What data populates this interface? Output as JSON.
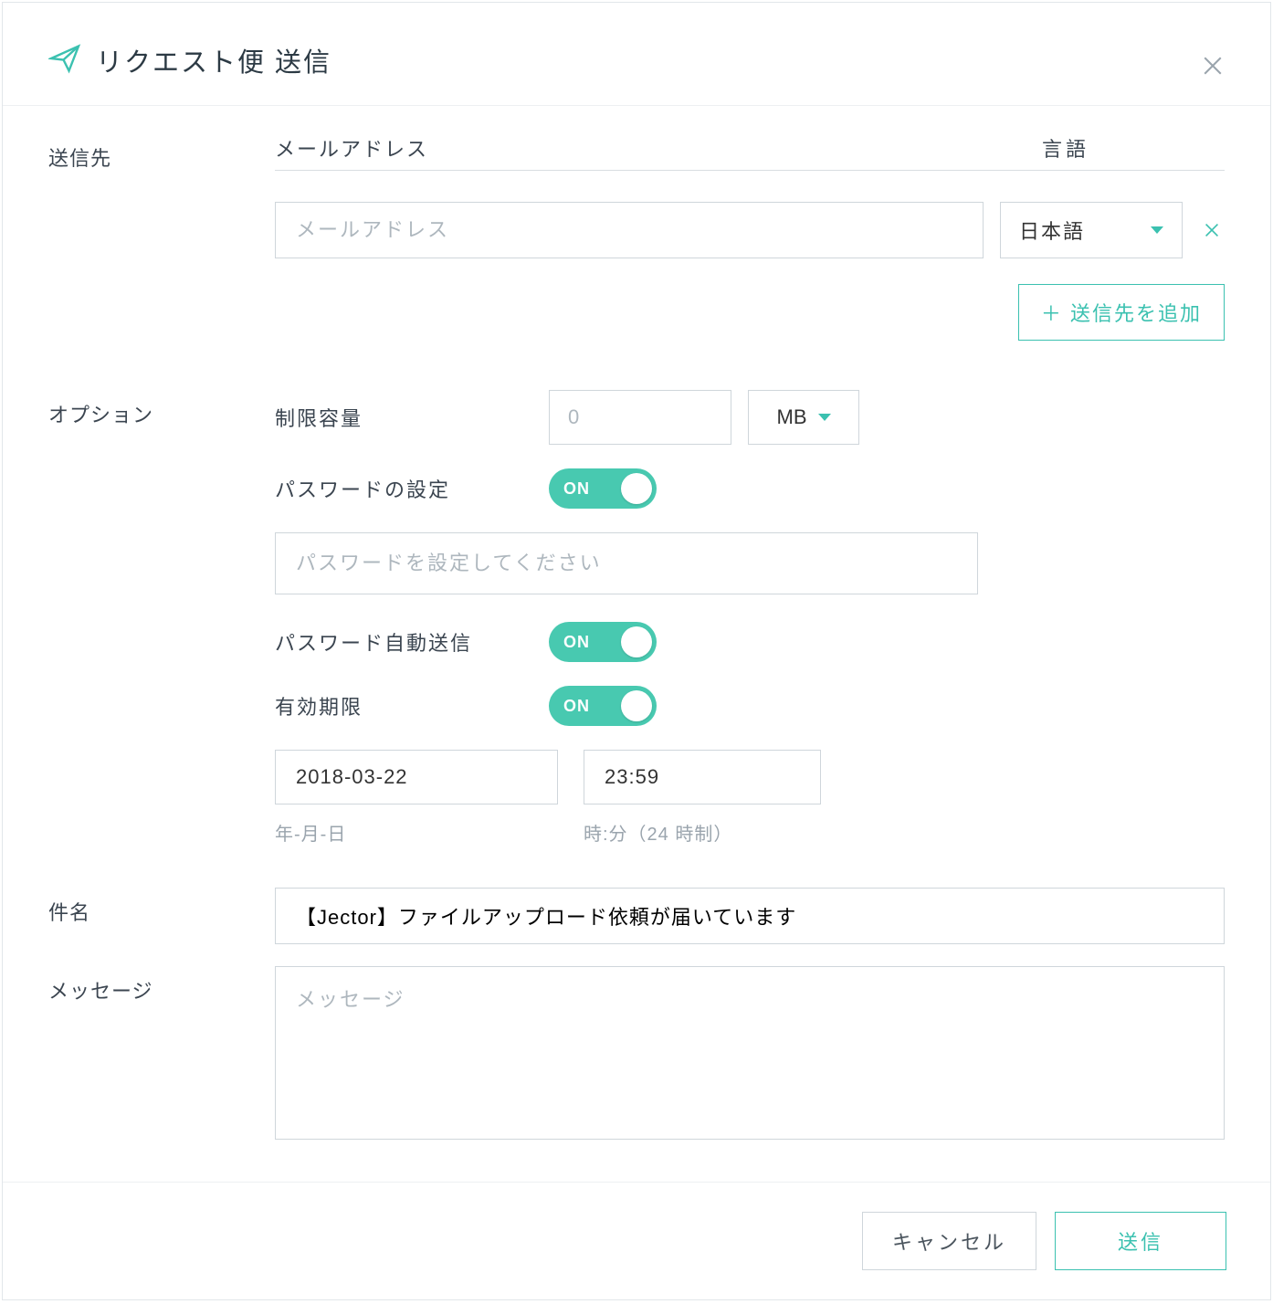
{
  "header": {
    "title": "リクエスト便 送信"
  },
  "recipients": {
    "side_label": "送信先",
    "email_header": "メールアドレス",
    "lang_header": "言語",
    "email_placeholder": "メールアドレス",
    "lang_selected": "日本語",
    "add_label": "＋ 送信先を追加"
  },
  "options": {
    "side_label": "オプション",
    "capacity_label": "制限容量",
    "capacity_placeholder": "0",
    "capacity_unit": "MB",
    "password_set_label": "パスワードの設定",
    "password_set_on": "ON",
    "password_placeholder": "パスワードを設定してください",
    "password_auto_label": "パスワード自動送信",
    "password_auto_on": "ON",
    "expiry_label": "有効期限",
    "expiry_on": "ON",
    "expiry_date": "2018-03-22",
    "expiry_time": "23:59",
    "expiry_date_hint": "年-月-日",
    "expiry_time_hint": "時:分（24 時制）"
  },
  "subject": {
    "side_label": "件名",
    "value": "【Jector】ファイルアップロード依頼が届いています"
  },
  "message": {
    "side_label": "メッセージ",
    "placeholder": "メッセージ"
  },
  "footer": {
    "cancel": "キャンセル",
    "send": "送信"
  }
}
